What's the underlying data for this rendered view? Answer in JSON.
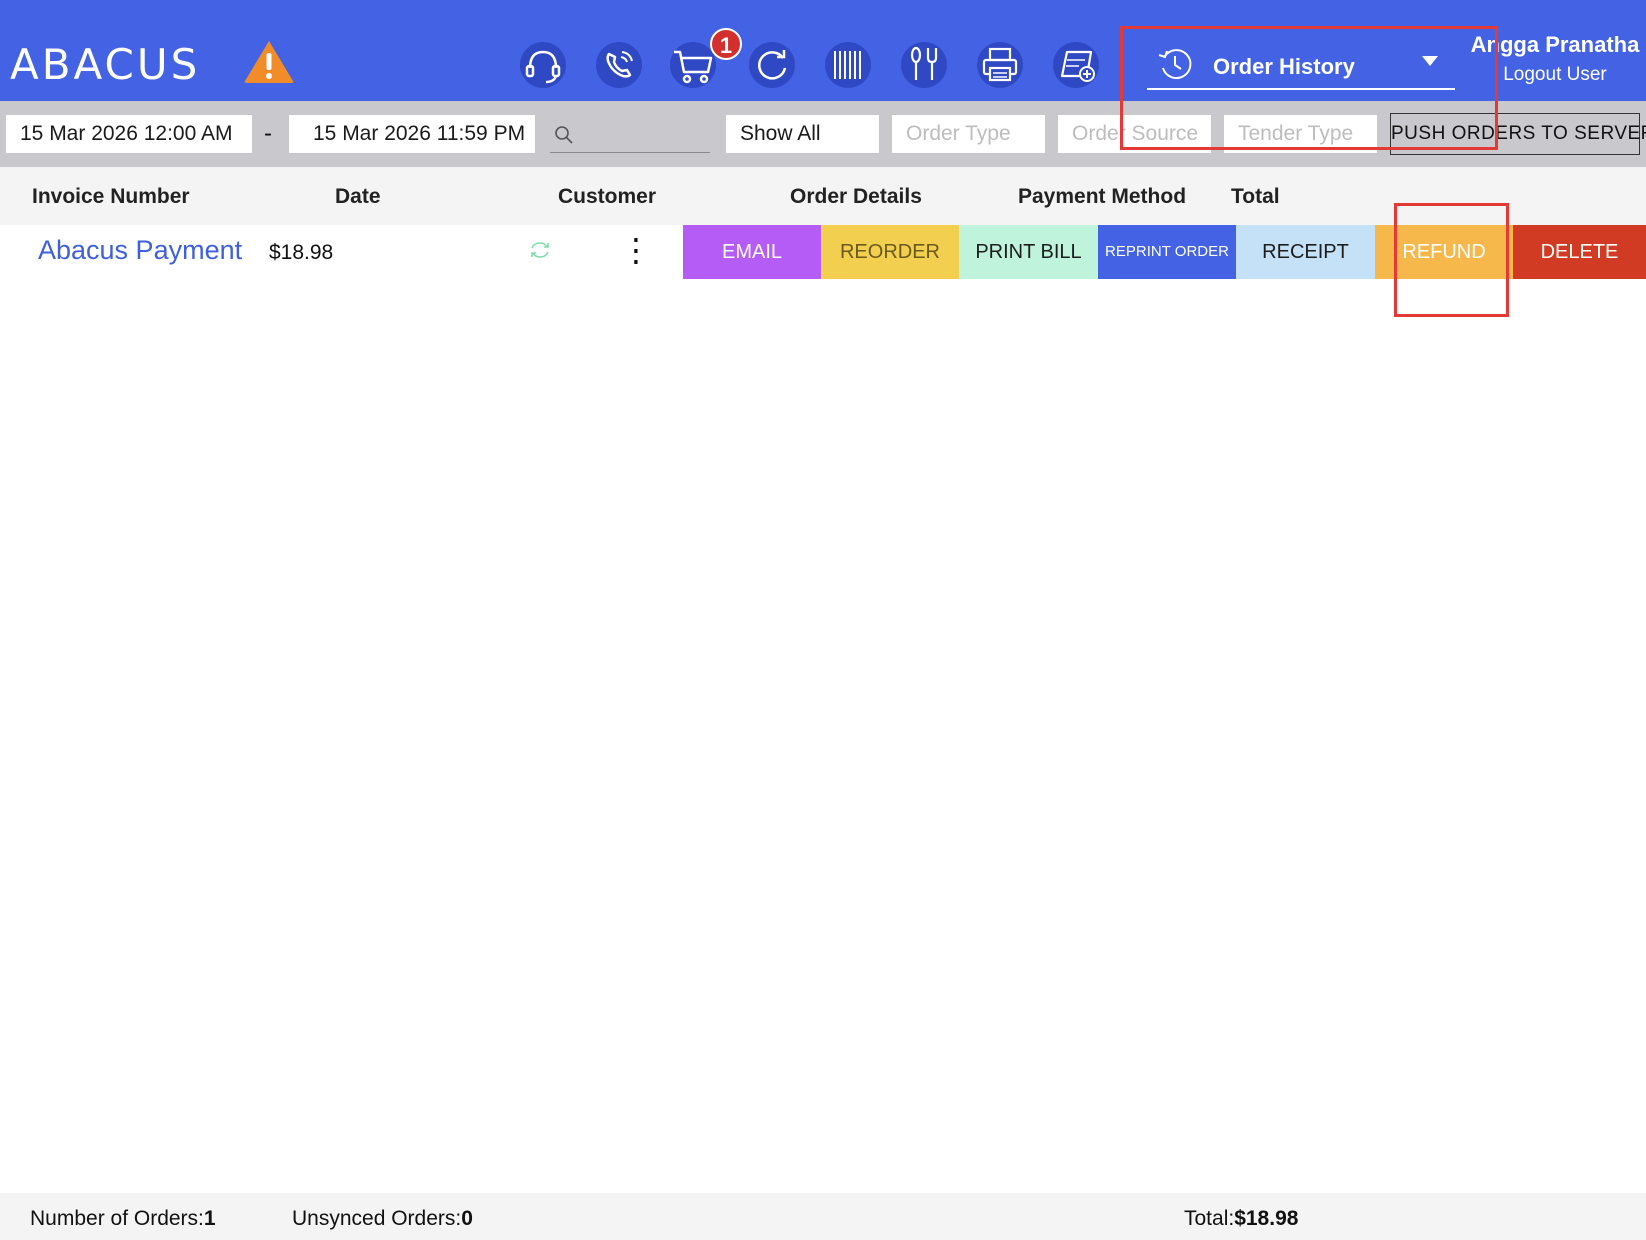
{
  "header": {
    "brand": "ABACUS",
    "icons": [
      "headset-icon",
      "phone-icon",
      "cart-icon",
      "refresh-icon",
      "barcode-icon",
      "dining-icon",
      "printer-icon",
      "add-device-icon"
    ],
    "cart_badge": "1",
    "view_selector": {
      "label": "Order History",
      "icon": "history-icon"
    },
    "user": {
      "name": "Angga Pranatha",
      "logout": "Logout User"
    }
  },
  "filters": {
    "start_date": "15 Mar 2026 12:00 AM",
    "separator": "-",
    "end_date": "15 Mar 2026 11:59 PM",
    "search_value": "",
    "status": "Show All",
    "order_type_placeholder": "Order Type",
    "order_source_placeholder": "Order Source",
    "tender_type_placeholder": "Tender Type",
    "push_button": "PUSH ORDERS TO SERVER"
  },
  "columns": [
    "Invoice Number",
    "Date",
    "Customer",
    "Order Details",
    "Payment Method",
    "Total"
  ],
  "orders": [
    {
      "prefix": ")",
      "invoice": "Abacus Payment",
      "amount": "$18.98",
      "actions": [
        "EMAIL",
        "REORDER",
        "PRINT BILL",
        "REPRINT ORDER",
        "RECEIPT",
        "REFUND",
        "DELETE"
      ]
    }
  ],
  "footer": {
    "orders_label": "Number of Orders:",
    "orders_count": "1",
    "unsynced_label": "Unsynced Orders:",
    "unsynced_count": "0",
    "total_label": "Total:",
    "total_value": "$18.98"
  },
  "colors": {
    "header_bg": "#4362e4",
    "email": "#b45cf5",
    "reorder": "#f2cf4f",
    "print_bill": "#bff3dc",
    "reprint_order": "#4362e4",
    "receipt": "#c5e1f7",
    "refund": "#f6b84a",
    "delete": "#d23b23",
    "annotation": "#e53935"
  }
}
